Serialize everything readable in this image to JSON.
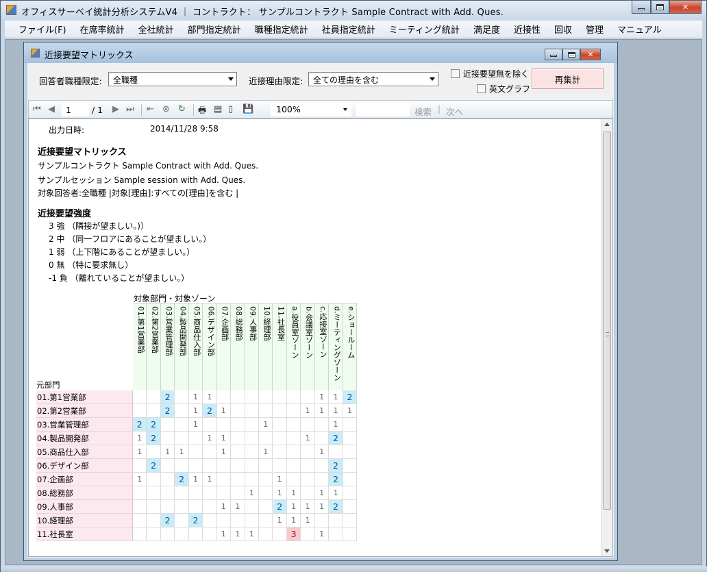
{
  "window": {
    "title": "オフィスサーベイ統計分析システムV4  ｜  コントラクト：  サンプルコントラクト Sample Contract with Add. Ques."
  },
  "menu": [
    "ファイル(F)",
    "在席率統計",
    "全社統計",
    "部門指定統計",
    "職種指定統計",
    "社員指定統計",
    "ミーティング統計",
    "満足度",
    "近接性",
    "回収",
    "管理",
    "マニュアル"
  ],
  "child": {
    "title": "近接要望マトリックス"
  },
  "filters": {
    "job_label": "回答者職種限定:",
    "job_value": "全職種",
    "reason_label": "近接理由限定:",
    "reason_value": "全ての理由を含む",
    "no_request_label": "近接要望無を除く",
    "english_graph_label": "英文グラフ",
    "recalc_label": "再集計"
  },
  "report_toolbar": {
    "page": "1",
    "page_total": "/ 1",
    "zoom": "100%",
    "find": "検索",
    "next": "次へ",
    "sep": "|"
  },
  "report": {
    "output_label": "出力日時:",
    "output_value": "2014/11/28 9:58",
    "title": "近接要望マトリックス",
    "contract": "サンプルコントラクト Sample Contract with Add. Ques.",
    "session": "サンプルセッション Sample session with Add. Ques.",
    "filter_line": "対象回答者:全職種 |対象[理由]:すべての[理由]を含む |",
    "strength_head": "近接要望強度",
    "strengths": [
      "3 強 （隣接が望ましい。)）",
      "2 中 （同一フロアにあることが望ましい。）",
      "1 弱 （上下階にあることが望ましい。）",
      "0 無 （特に要求無し）",
      "-1 負 （離れていることが望ましい。）"
    ],
    "col_group_label": "対象部門・対象ゾーン",
    "row_group_label": "元部門"
  },
  "matrix": {
    "columns": [
      "01.第1営業部",
      "02.第2営業部",
      "03.営業管理部",
      "04.製品開発部",
      "05.商品仕入部",
      "06.デザイン部",
      "07.企画部",
      "08.総務部",
      "09.人事部",
      "10.経理部",
      "11.社長室",
      "a.役員室ゾーン",
      "b.会議室ゾーン",
      "c.応接室ゾーン",
      "d.ミーティングゾーン",
      "e.ショールーム"
    ],
    "rows": [
      {
        "label": "01.第1営業部",
        "cells": [
          "",
          "",
          "2",
          "",
          "1",
          "1",
          "",
          "",
          "",
          "",
          "",
          "",
          "",
          "1",
          "1",
          "2"
        ]
      },
      {
        "label": "02.第2営業部",
        "cells": [
          "",
          "",
          "2",
          "",
          "1",
          "2",
          "1",
          "",
          "",
          "",
          "",
          "",
          "1",
          "1",
          "1",
          "1"
        ]
      },
      {
        "label": "03.営業管理部",
        "cells": [
          "2",
          "2",
          "",
          "",
          "1",
          "",
          "",
          "",
          "",
          "1",
          "",
          "",
          "",
          "",
          "1",
          ""
        ]
      },
      {
        "label": "04.製品開発部",
        "cells": [
          "1",
          "2",
          "",
          "",
          "",
          "1",
          "1",
          "",
          "",
          "",
          "",
          "",
          "1",
          "",
          "2",
          ""
        ]
      },
      {
        "label": "05.商品仕入部",
        "cells": [
          "1",
          "",
          "1",
          "1",
          "",
          "",
          "1",
          "",
          "",
          "1",
          "",
          "",
          "",
          "1",
          "",
          ""
        ]
      },
      {
        "label": "06.デザイン部",
        "cells": [
          "",
          "2",
          "",
          "",
          "",
          "",
          "",
          "",
          "",
          "",
          "",
          "",
          "",
          "",
          "2",
          ""
        ]
      },
      {
        "label": "07.企画部",
        "cells": [
          "1",
          "",
          "",
          "2",
          "1",
          "1",
          "",
          "",
          "",
          "",
          "1",
          "",
          "",
          "",
          "2",
          ""
        ]
      },
      {
        "label": "08.総務部",
        "cells": [
          "",
          "",
          "",
          "",
          "",
          "",
          "",
          "",
          "1",
          "",
          "1",
          "1",
          "",
          "1",
          "1",
          ""
        ]
      },
      {
        "label": "09.人事部",
        "cells": [
          "",
          "",
          "",
          "",
          "",
          "",
          "1",
          "1",
          "",
          "",
          "2",
          "1",
          "1",
          "1",
          "2",
          ""
        ]
      },
      {
        "label": "10.経理部",
        "cells": [
          "",
          "",
          "2",
          "",
          "2",
          "",
          "",
          "",
          "",
          "",
          "1",
          "1",
          "1",
          "",
          "",
          ""
        ]
      },
      {
        "label": "11.社長室",
        "cells": [
          "",
          "",
          "",
          "",
          "",
          "",
          "1",
          "1",
          "1",
          "",
          "",
          "3",
          "",
          "1",
          "",
          ""
        ]
      }
    ]
  },
  "colors": {
    "row_header_bg": "#fce9ef",
    "col_header_bg": "#effcef",
    "strength2_bg": "#c8ecf8",
    "strength3_bg": "#f8c9cf"
  }
}
